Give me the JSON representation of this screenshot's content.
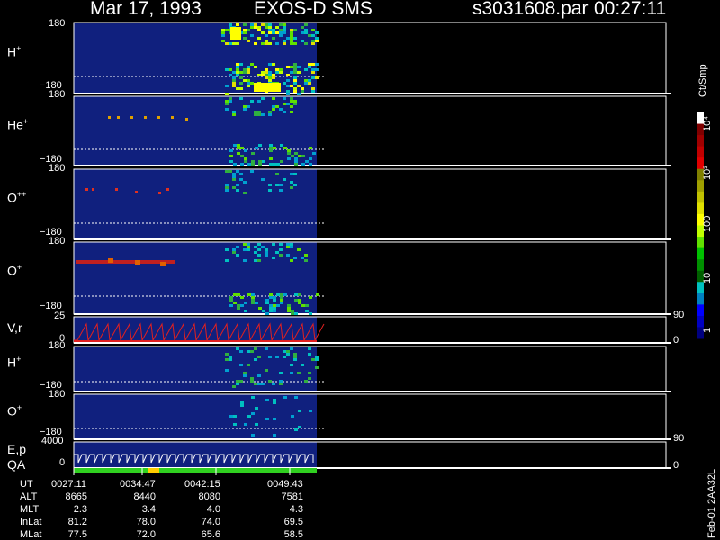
{
  "header": {
    "date": "Mar 17, 1993",
    "instrument": "EXOS-D SMS",
    "file": "s3031608.par",
    "time": "00:27:11"
  },
  "panels": [
    {
      "label": "H",
      "sup": "+",
      "top_tick": "180",
      "bot_tick": "−180"
    },
    {
      "label": "He",
      "sup": "+",
      "top_tick": "180",
      "bot_tick": "−180"
    },
    {
      "label": "O",
      "sup": "++",
      "top_tick": "180",
      "bot_tick": "−180"
    },
    {
      "label": "O",
      "sup": "+",
      "top_tick": "180",
      "bot_tick": "−180"
    },
    {
      "label": "V,r",
      "sup": "",
      "top_tick": "25",
      "bot_tick": "0",
      "right_top": "90",
      "right_bot": "0"
    },
    {
      "label": "H",
      "sup": "+",
      "top_tick": "180",
      "bot_tick": "−180"
    },
    {
      "label": "O",
      "sup": "+",
      "top_tick": "180",
      "bot_tick": "−180"
    },
    {
      "label": "E,p",
      "sup": "",
      "top_tick": "4000",
      "bot_tick": "0",
      "right_top": "90",
      "right_bot": "0"
    }
  ],
  "qa_label": "QA",
  "colorbar": {
    "unit": "Ct/Smp",
    "ticks": [
      "10⁴",
      "10³",
      "100",
      "10",
      "1"
    ],
    "colors": [
      "#ffffff",
      "#800000",
      "#a00000",
      "#c00000",
      "#e00000",
      "#808000",
      "#a0a000",
      "#c0c000",
      "#e0e000",
      "#ffff00",
      "#c0ff00",
      "#60e000",
      "#00c000",
      "#009000",
      "#006000",
      "#00c0c0",
      "#0080c0",
      "#0000ff",
      "#0000c0",
      "#000080"
    ]
  },
  "footer_id": "Feb-01 2AA32L",
  "chart_data": {
    "type": "heatmap",
    "x_ticks": [
      "0027:11",
      "0034:47",
      "0042:15",
      "0049:43"
    ],
    "rows": [
      {
        "label": "UT",
        "values": [
          "0027:11",
          "0034:47",
          "0042:15",
          "0049:43"
        ]
      },
      {
        "label": "ALT",
        "values": [
          "8665",
          "8440",
          "8080",
          "7581"
        ]
      },
      {
        "label": "MLT",
        "values": [
          "2.3",
          "3.4",
          "4.0",
          "4.3"
        ]
      },
      {
        "label": "InLat",
        "values": [
          "81.2",
          "78.0",
          "74.0",
          "69.5"
        ]
      },
      {
        "label": "MLat",
        "values": [
          "77.5",
          "72.0",
          "65.6",
          "58.5"
        ]
      }
    ],
    "y_range_pitch": [
      -180,
      180
    ],
    "vr_range": [
      0,
      25
    ],
    "ep_range": [
      0,
      4000
    ]
  }
}
